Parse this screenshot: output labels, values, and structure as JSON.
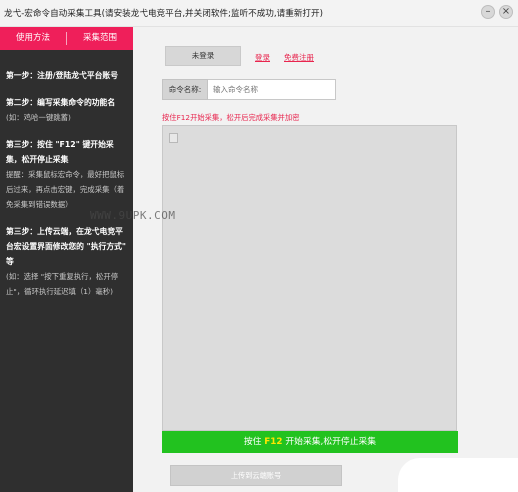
{
  "window": {
    "title": "龙弋-宏命令自动采集工具(请安装龙弋电竞平台,并关闭软件;监听不成功,请重新打开)",
    "minimize_glyph": "–",
    "close_glyph": "×"
  },
  "sidebar": {
    "tabs": [
      {
        "label": "使用方法",
        "active": true
      },
      {
        "label": "采集范围",
        "active": false
      }
    ],
    "steps": [
      {
        "title": "第一步：注册/登陆龙弋平台账号",
        "desc": ""
      },
      {
        "title": "第二步：编写采集命令的功能名",
        "desc": "(如：鸡哈一键跳蓄)"
      },
      {
        "title": "第三步：按住 \"F12\" 键开始采集，松开停止采集",
        "desc": "提醒：采集鼠标宏命令，最好把鼠标后过来，再点击宏键，完成采集（着免采集到错误数据）"
      },
      {
        "title": "第三步：上传云端，在龙弋电竞平台宏设置界面修改您的 \"执行方式\" 等",
        "desc": "(如：选择 \"按下重复执行，松开停止\"，循环执行延迟填（1）毫秒)"
      }
    ]
  },
  "main": {
    "login_button": "未登录",
    "login_link": "登录",
    "register_link": "免费注册",
    "command": {
      "label": "命令名称:",
      "value": "",
      "placeholder": "输入命令名称"
    },
    "hint": "按住F12开始采集，松开后完成采集并加密",
    "watermark": "WWW.9UPK.COM",
    "start_bar": {
      "prefix": "按住",
      "key": "F12",
      "suffix": "开始采集,松开停止采集"
    },
    "upload_button": "上传到云端账号"
  },
  "colors": {
    "accent": "#ef1f5a",
    "sidebar_bg": "#2f2f2f",
    "start_bar": "#22c21f",
    "link": "#e8254e"
  }
}
